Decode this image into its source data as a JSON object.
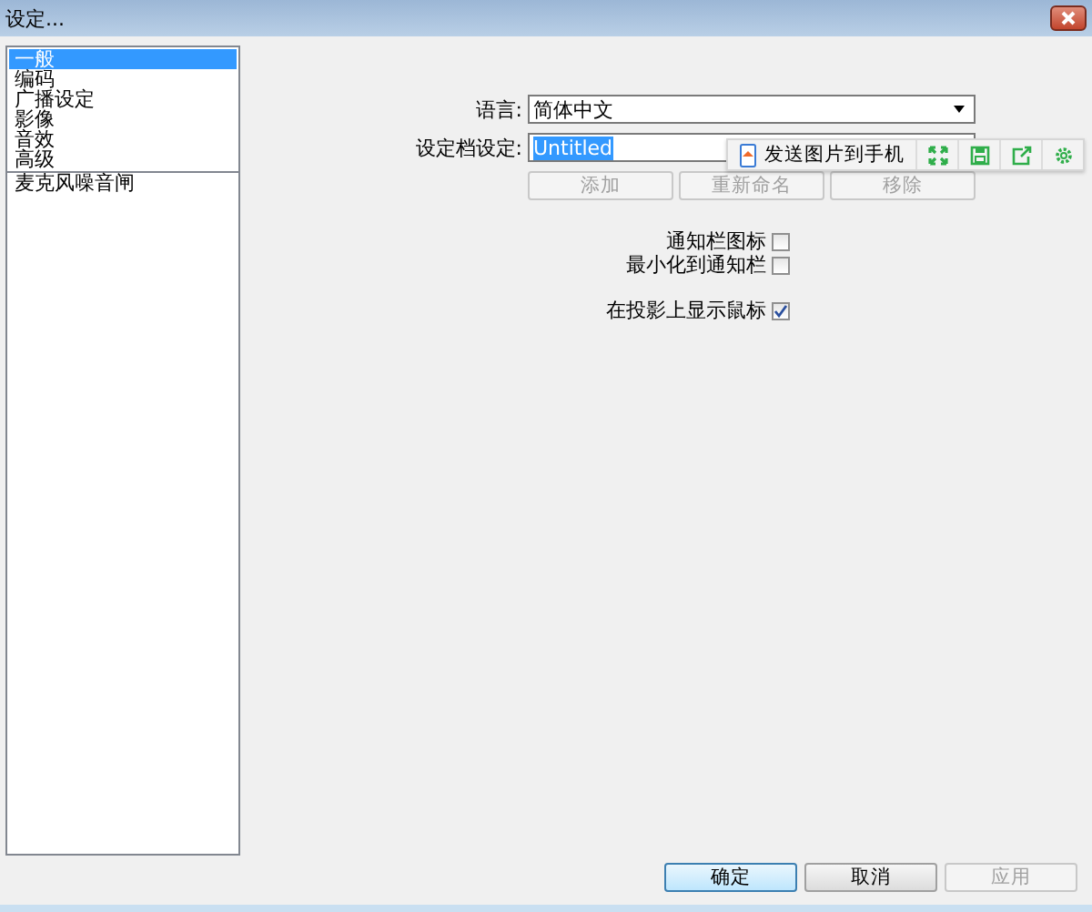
{
  "window": {
    "title": "设定..."
  },
  "sidebar": {
    "items": [
      {
        "label": "一般",
        "selected": true
      },
      {
        "label": "编码",
        "selected": false
      },
      {
        "label": "广播设定",
        "selected": false
      },
      {
        "label": "影像",
        "selected": false
      },
      {
        "label": "音效",
        "selected": false
      },
      {
        "label": "高级",
        "selected": false
      }
    ],
    "extra_items": [
      {
        "label": "麦克风噪音闸",
        "selected": false
      }
    ]
  },
  "language": {
    "label": "语言:",
    "value": "简体中文"
  },
  "profile": {
    "label": "设定档设定:",
    "value": "Untitled",
    "buttons": [
      {
        "label": "添加",
        "disabled": true
      },
      {
        "label": "重新命名",
        "disabled": true
      },
      {
        "label": "移除",
        "disabled": true
      }
    ]
  },
  "options": [
    {
      "label": "通知栏图标",
      "checked": false
    },
    {
      "label": "最小化到通知栏",
      "checked": false
    },
    {
      "label": "在投影上显示鼠标",
      "checked": true
    }
  ],
  "overlay_toolbar": {
    "label": "发送图片到手机"
  },
  "footer_buttons": [
    {
      "label": "确定",
      "disabled": false,
      "default": true
    },
    {
      "label": "取消",
      "disabled": false,
      "default": false
    },
    {
      "label": "应用",
      "disabled": true,
      "default": false
    }
  ]
}
